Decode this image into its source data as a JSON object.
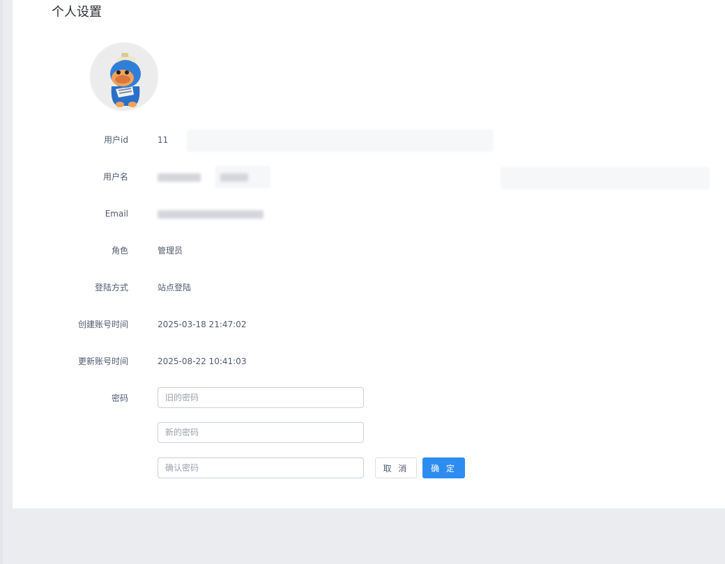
{
  "page": {
    "title": "个人设置"
  },
  "profile": {
    "avatar_icon": "camel-mascot-avatar",
    "fields": [
      {
        "label": "用户id",
        "value": "11"
      },
      {
        "label": "用户名",
        "value": ""
      },
      {
        "label": "Email",
        "value": ""
      },
      {
        "label": "角色",
        "value": "管理员"
      },
      {
        "label": "登陆方式",
        "value": "站点登陆"
      },
      {
        "label": "创建账号时间",
        "value": "2025-03-18 21:47:02"
      },
      {
        "label": "更新账号时间",
        "value": "2025-08-22 10:41:03"
      }
    ]
  },
  "password": {
    "label": "密码",
    "old_placeholder": "旧的密码",
    "new_placeholder": "新的密码",
    "confirm_placeholder": "确认密码",
    "cancel_label": "取 消",
    "ok_label": "确 定"
  },
  "colors": {
    "primary": "#2d8cf0",
    "background": "#ebecf0",
    "card": "#ffffff"
  }
}
